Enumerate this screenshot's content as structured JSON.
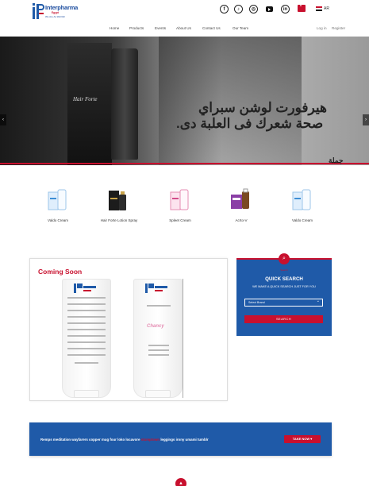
{
  "brand": {
    "name": "Interpharma",
    "sub": "Egypt",
    "tagline": "We Are As Well Eh",
    "colors": {
      "blue": "#1f5aa8",
      "red": "#c8102e"
    }
  },
  "header": {
    "social_icons": [
      "facebook-icon",
      "tiktok-icon",
      "instagram-icon",
      "youtube-icon",
      "linkedin-icon"
    ],
    "cart_count": "0",
    "language": "AR"
  },
  "nav": {
    "items": [
      "Home",
      "Products",
      "Events",
      "About Us",
      "Contact Us",
      "Our Team"
    ],
    "login": "Log in",
    "register": "Register"
  },
  "hero": {
    "brand_text": "Hair Forte",
    "line1": "هيرفورت لوشن سبراي",
    "line2": "صحة شعرك فى العلبة دى.",
    "tail": "جملة"
  },
  "products": [
    {
      "name": "Valdo Cream"
    },
    {
      "name": "Hair Forte Lotion Spray"
    },
    {
      "name": "Spleet Cream"
    },
    {
      "name": "Acrto-V"
    },
    {
      "name": "Valdo Cream"
    }
  ],
  "coming_soon": {
    "title": "Coming Soon",
    "product_logo": "Chancy"
  },
  "quick_search": {
    "mini_label": "Search",
    "title": "QUICK SEARCH",
    "subtitle": "WE MAKE A QUICK SEARCH JUST FOR YOU",
    "select_value": "Select Brand",
    "button": "SEARCH"
  },
  "cta": {
    "text_before": "Remps meditation wayfarers copper mug four loko locavore",
    "highlight": "stumptown",
    "text_after": "leggings irony umami tumblr",
    "button": "TAKE NOW"
  }
}
